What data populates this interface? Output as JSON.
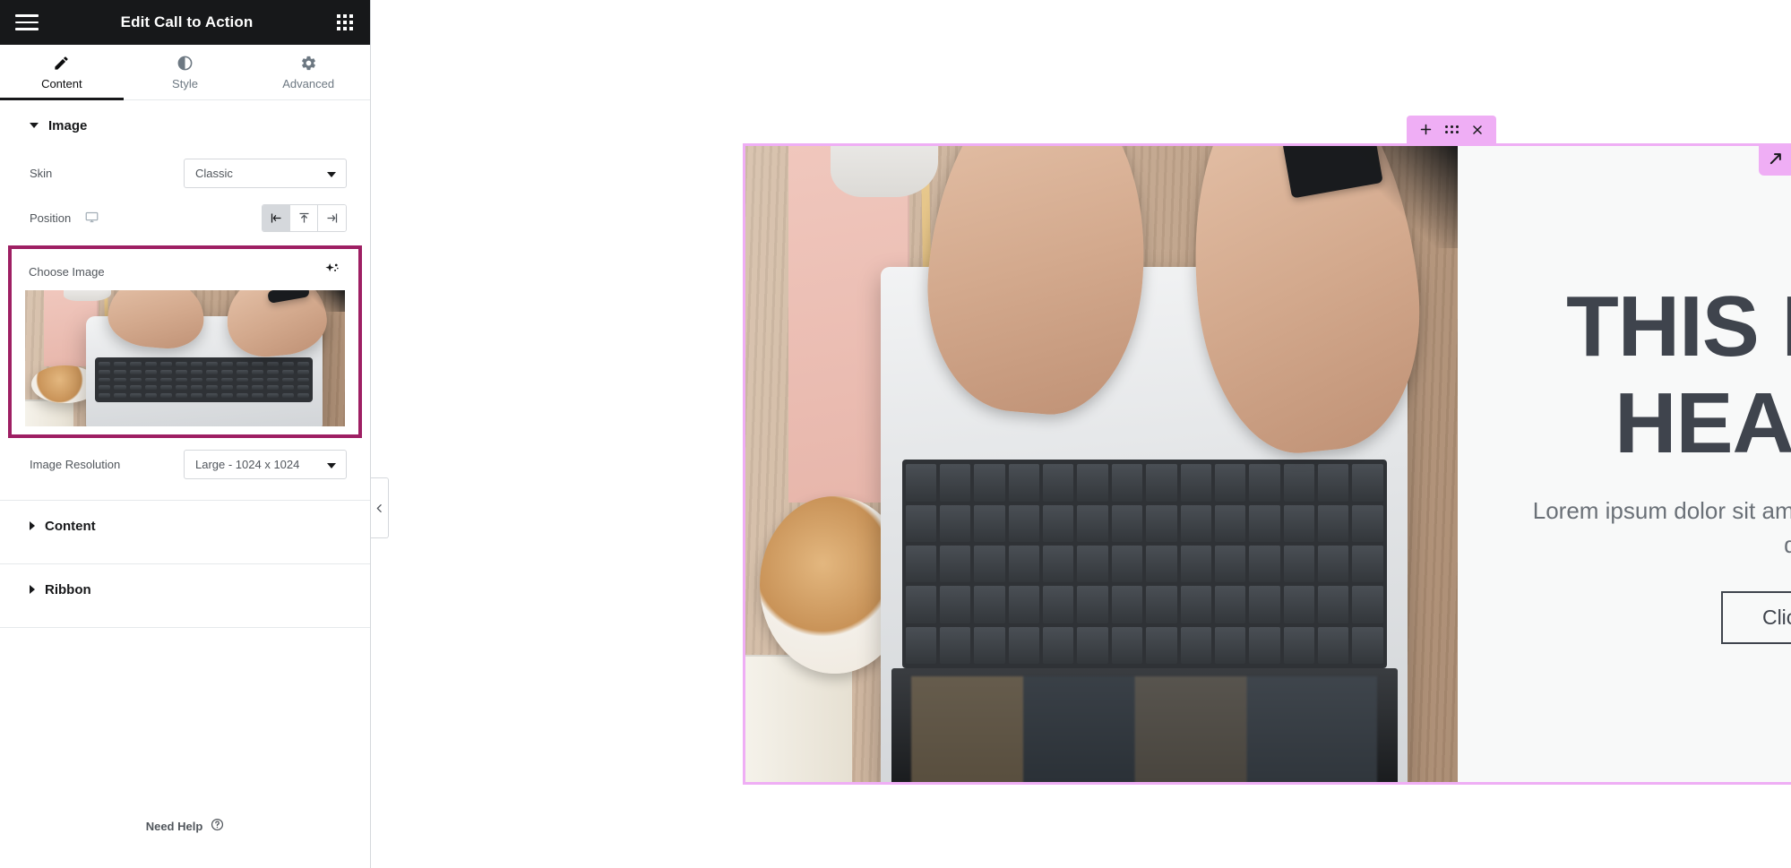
{
  "panel": {
    "header": {
      "title": "Edit Call to Action",
      "menu_icon": "hamburger-icon",
      "apps_icon": "grid-apps-icon"
    },
    "tabs": [
      {
        "label": "Content",
        "icon": "pencil-icon",
        "active": true
      },
      {
        "label": "Style",
        "icon": "contrast-icon",
        "active": false
      },
      {
        "label": "Advanced",
        "icon": "gear-icon",
        "active": false
      }
    ],
    "sections": [
      {
        "id": "image",
        "label": "Image",
        "expanded": true
      },
      {
        "id": "content",
        "label": "Content",
        "expanded": false
      },
      {
        "id": "ribbon",
        "label": "Ribbon",
        "expanded": false
      }
    ],
    "controls": {
      "skin": {
        "label": "Skin",
        "value": "Classic"
      },
      "position": {
        "label": "Position",
        "device_icon": "desktop-monitor-icon",
        "options": [
          {
            "name": "align-left",
            "selected": true
          },
          {
            "name": "align-top",
            "selected": false
          },
          {
            "name": "align-right",
            "selected": false
          }
        ]
      },
      "choose_image": {
        "label": "Choose Image",
        "ai_icon": "ai-sparkle-icon",
        "highlighted": true,
        "highlight_color": "#9e1f63"
      },
      "image_resolution": {
        "label": "Image Resolution",
        "value": "Large - 1024 x 1024"
      }
    },
    "footer": {
      "label": "Need Help",
      "icon": "question-circle-icon"
    },
    "collapse_handle_icon": "chevron-left-icon"
  },
  "canvas": {
    "toolbar": {
      "color": "#efaef5",
      "buttons": [
        {
          "name": "add-widget",
          "icon": "plus-icon"
        },
        {
          "name": "drag-widget",
          "icon": "drag-dots-icon"
        },
        {
          "name": "delete-widget",
          "icon": "close-icon"
        }
      ]
    },
    "widget": {
      "selection_color": "#efaef5",
      "heading": "THIS IS THE HEADING",
      "description": "Lorem ipsum dolor sit amet consectetur adipiscing elit dolor",
      "button_label": "Click Here",
      "heading_color": "#3f444d",
      "background_color": "#f8f9f9",
      "image_alt": "hands typing on laptop at wooden desk"
    },
    "resize_handle_icon": "resize-arrow-icon"
  }
}
